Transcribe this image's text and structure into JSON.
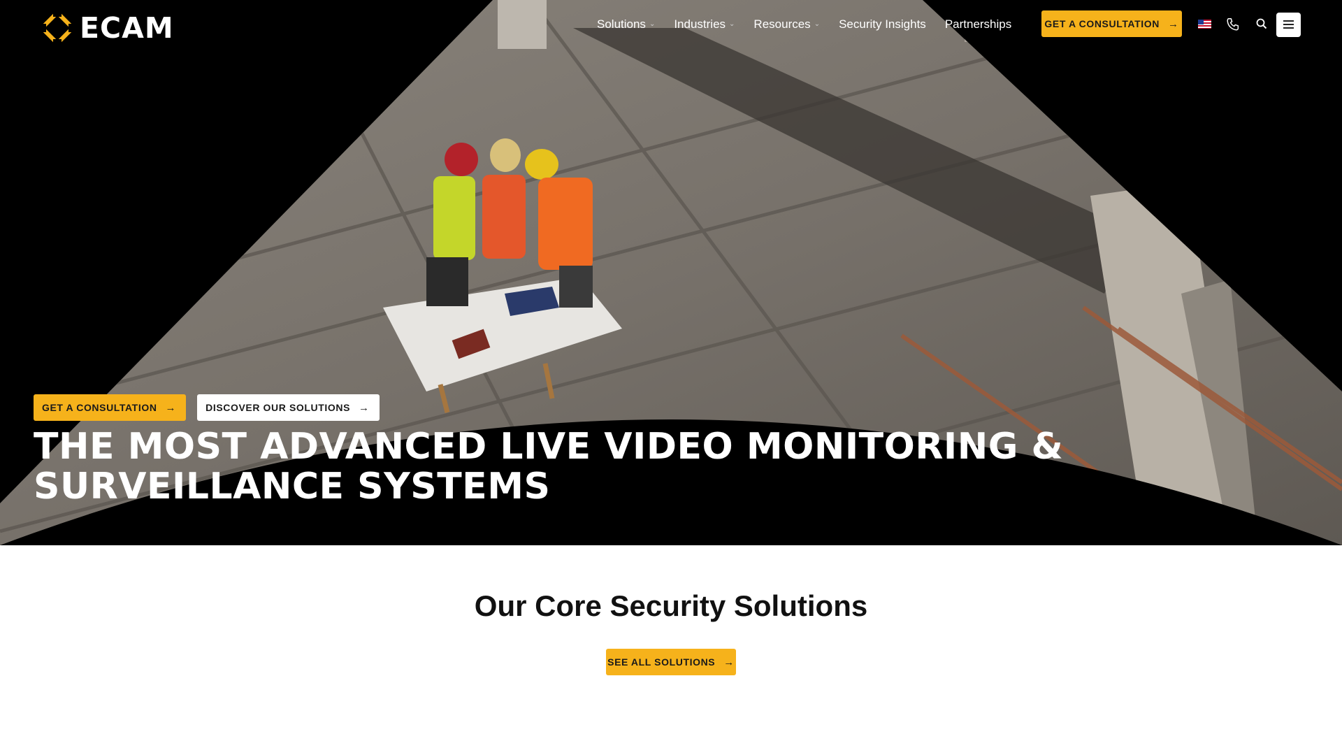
{
  "header": {
    "logo_text": "ECAM",
    "nav": [
      {
        "label": "Solutions",
        "has_dropdown": true
      },
      {
        "label": "Industries",
        "has_dropdown": true
      },
      {
        "label": "Resources",
        "has_dropdown": true
      },
      {
        "label": "Security Insights",
        "has_dropdown": false
      },
      {
        "label": "Partnerships",
        "has_dropdown": false
      }
    ],
    "cta_label": "GET A CONSULTATION",
    "icons": [
      "us-flag-icon",
      "phone-icon",
      "search-icon",
      "hamburger-menu-icon"
    ]
  },
  "hero": {
    "primary_cta": "GET A CONSULTATION",
    "secondary_cta": "DISCOVER OUR SOLUTIONS",
    "headline_line1": "THE MOST ADVANCED LIVE VIDEO MONITORING &",
    "headline_line2": "SURVEILLANCE SYSTEMS"
  },
  "solutions": {
    "title": "Our Core Security Solutions",
    "cta_label": "SEE ALL SOLUTIONS"
  },
  "colors": {
    "accent": "#f6b21b",
    "hero_bg": "#000000",
    "page_bg": "#ffffff"
  }
}
